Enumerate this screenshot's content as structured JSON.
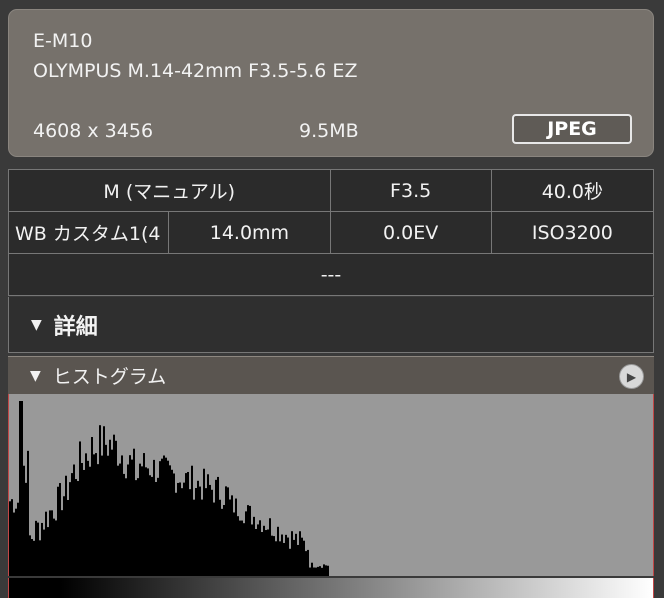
{
  "info": {
    "camera": "E-M10",
    "lens": "OLYMPUS M.14-42mm F3.5-5.6 EZ",
    "resolution": "4608 x 3456",
    "file_size": "9.5MB",
    "format": "JPEG"
  },
  "exif": {
    "mode": "M (マニュアル)",
    "aperture": "F3.5",
    "shutter": "40.0秒",
    "white_balance": "WB カスタム1(4",
    "focal_length": "14.0mm",
    "exposure_comp": "0.0EV",
    "iso": "ISO3200",
    "extra": "---"
  },
  "sections": {
    "details_label": "詳細",
    "histogram_label": "ヒストグラム",
    "toggle_icon": "▼",
    "play_icon": "▶"
  },
  "colors": {
    "card_bg": "#76716b",
    "panel_bg": "#2b2b2b",
    "histogram_bg": "#999999",
    "histogram_bar": "#000000",
    "edge_marker": "#c24747"
  }
}
